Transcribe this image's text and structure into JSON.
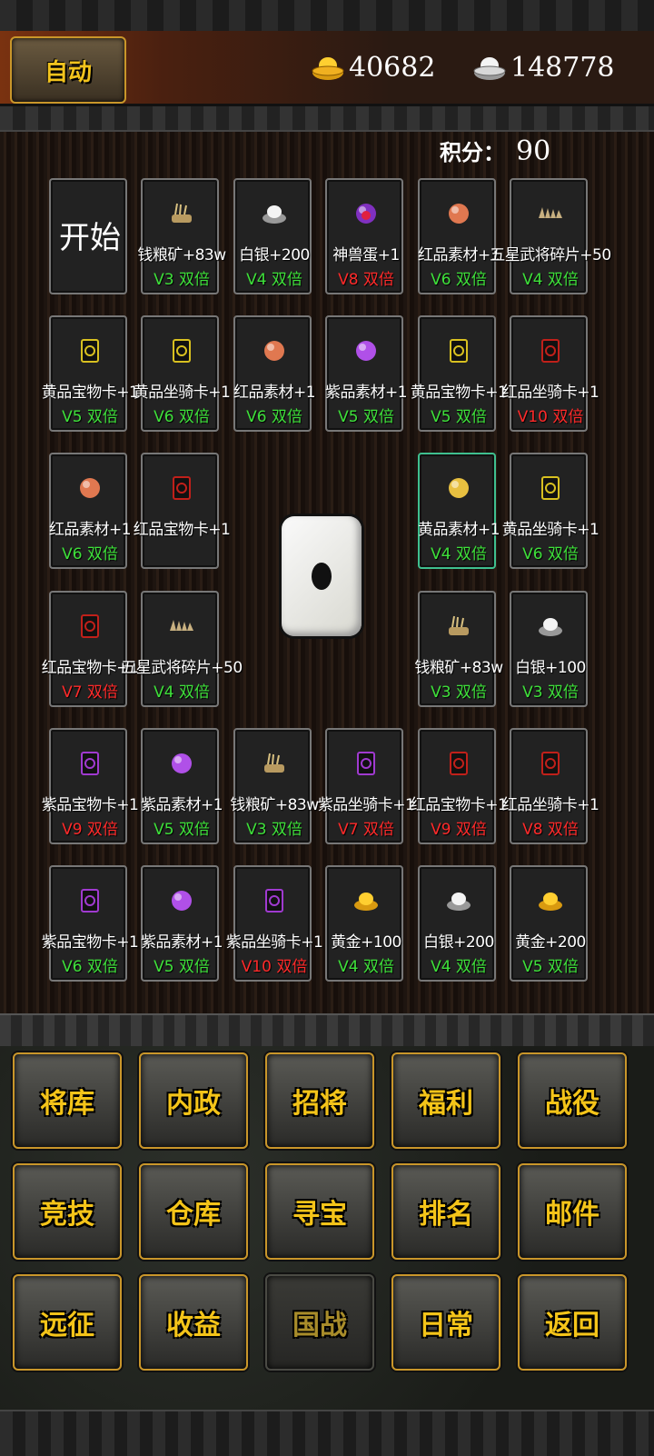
{
  "header": {
    "auto_label": "自动",
    "gold_amount": "40682",
    "silver_amount": "148778"
  },
  "score": {
    "label": "积分：",
    "value": "90"
  },
  "board": {
    "start_label": "开始",
    "cells": [
      {
        "icon": "grain-ore-icon",
        "name": "钱粮矿+83w",
        "tag": "V3 双倍",
        "color": "green"
      },
      {
        "icon": "silver-ingot-icon",
        "name": "白银+200",
        "tag": "V4 双倍",
        "color": "green"
      },
      {
        "icon": "beast-egg-icon",
        "name": "神兽蛋+1",
        "tag": "V8 双倍",
        "color": "red"
      },
      {
        "icon": "red-material-icon",
        "name": "红品素材+1",
        "tag": "V6 双倍",
        "color": "green"
      },
      {
        "icon": "general-fragment-icon",
        "name": "五星武将碎片+50",
        "tag": "V4 双倍",
        "color": "green"
      },
      {
        "icon": "yellow-treasure-card-icon",
        "name": "黄品宝物卡+1",
        "tag": "V5 双倍",
        "color": "green"
      },
      {
        "icon": "yellow-mount-card-icon",
        "name": "黄品坐骑卡+1",
        "tag": "V6 双倍",
        "color": "green"
      },
      {
        "icon": "red-material-icon",
        "name": "红品素材+1",
        "tag": "V6 双倍",
        "color": "green"
      },
      {
        "icon": "purple-material-icon",
        "name": "紫品素材+1",
        "tag": "V5 双倍",
        "color": "green"
      },
      {
        "icon": "yellow-treasure-card-icon",
        "name": "黄品宝物卡+1",
        "tag": "V5 双倍",
        "color": "green"
      },
      {
        "icon": "red-mount-card-icon",
        "name": "红品坐骑卡+1",
        "tag": "V10 双倍",
        "color": "red"
      },
      {
        "icon": "red-material-icon",
        "name": "红品素材+1",
        "tag": "V6 双倍",
        "color": "green"
      },
      {
        "icon": "red-treasure-card-icon",
        "name": "红品宝物卡+1",
        "tag": "",
        "color": "green"
      },
      {
        "icon": "yellow-material-icon",
        "name": "黄品素材+1",
        "tag": "V4 双倍",
        "color": "green"
      },
      {
        "icon": "yellow-mount-card-icon",
        "name": "黄品坐骑卡+1",
        "tag": "V6 双倍",
        "color": "green"
      },
      {
        "icon": "red-treasure-card-icon",
        "name": "红品宝物卡+1",
        "tag": "V7 双倍",
        "color": "red"
      },
      {
        "icon": "general-fragment-icon",
        "name": "五星武将碎片+50",
        "tag": "V4 双倍",
        "color": "green"
      },
      {
        "icon": "grain-ore-icon",
        "name": "钱粮矿+83w",
        "tag": "V3 双倍",
        "color": "green"
      },
      {
        "icon": "silver-ingot-icon",
        "name": "白银+100",
        "tag": "V3 双倍",
        "color": "green"
      },
      {
        "icon": "purple-treasure-card-icon",
        "name": "紫品宝物卡+1",
        "tag": "V9 双倍",
        "color": "red"
      },
      {
        "icon": "purple-material-icon",
        "name": "紫品素材+1",
        "tag": "V5 双倍",
        "color": "green"
      },
      {
        "icon": "grain-ore-icon",
        "name": "钱粮矿+83w",
        "tag": "V3 双倍",
        "color": "green"
      },
      {
        "icon": "purple-mount-card-icon",
        "name": "紫品坐骑卡+1",
        "tag": "V7 双倍",
        "color": "red"
      },
      {
        "icon": "red-treasure-card-icon",
        "name": "红品宝物卡+1",
        "tag": "V9 双倍",
        "color": "red"
      },
      {
        "icon": "red-mount-card-icon",
        "name": "红品坐骑卡+1",
        "tag": "V8 双倍",
        "color": "red"
      },
      {
        "icon": "purple-treasure-card-icon",
        "name": "紫品宝物卡+1",
        "tag": "V6 双倍",
        "color": "green"
      },
      {
        "icon": "purple-material-icon",
        "name": "紫品素材+1",
        "tag": "V5 双倍",
        "color": "green"
      },
      {
        "icon": "purple-mount-card-icon",
        "name": "紫品坐骑卡+1",
        "tag": "V10 双倍",
        "color": "red"
      },
      {
        "icon": "gold-ingot-icon",
        "name": "黄金+100",
        "tag": "V4 双倍",
        "color": "green"
      },
      {
        "icon": "silver-ingot-icon",
        "name": "白银+200",
        "tag": "V4 双倍",
        "color": "green"
      },
      {
        "icon": "gold-ingot-icon",
        "name": "黄金+200",
        "tag": "V5 双倍",
        "color": "green"
      }
    ]
  },
  "menu": [
    {
      "label": "将库"
    },
    {
      "label": "内政"
    },
    {
      "label": "招将"
    },
    {
      "label": "福利"
    },
    {
      "label": "战役"
    },
    {
      "label": "竞技"
    },
    {
      "label": "仓库"
    },
    {
      "label": "寻宝"
    },
    {
      "label": "排名"
    },
    {
      "label": "邮件"
    },
    {
      "label": "远征"
    },
    {
      "label": "收益"
    },
    {
      "label": "国战"
    },
    {
      "label": "日常"
    },
    {
      "label": "返回"
    }
  ],
  "colors": {
    "tag_green": "#3ee03a",
    "tag_red": "#ff2a2a",
    "menu_text": "#f4c419",
    "selected_border": "#3fbf8f"
  }
}
